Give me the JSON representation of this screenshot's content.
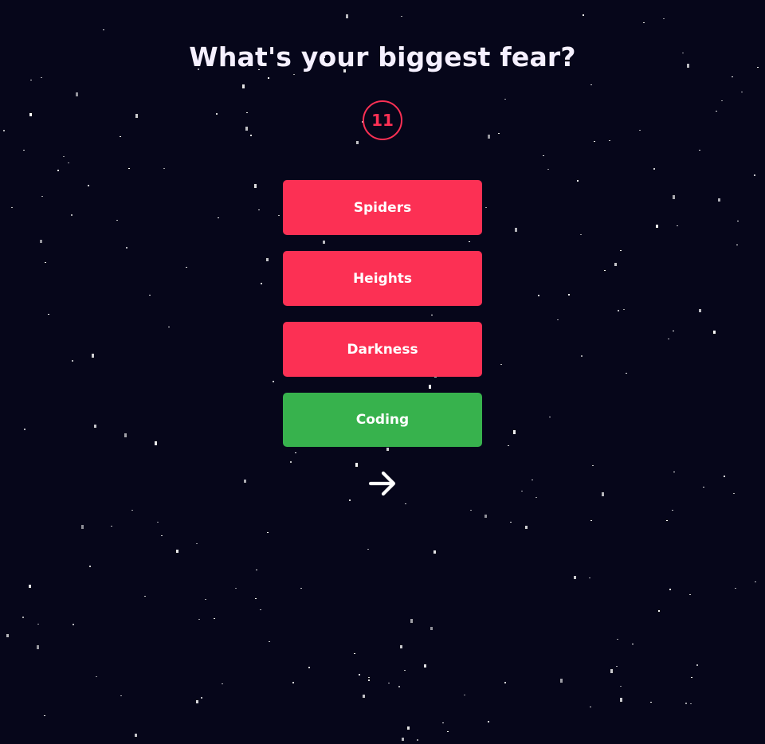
{
  "theme": {
    "background": "#06061a",
    "star_color": "#ffffff",
    "accent_red": "#fc3054",
    "correct_green": "#37b24d",
    "text_light": "#f5f0ff"
  },
  "quiz": {
    "question": "What's your biggest fear?",
    "timer": "11",
    "answers": [
      {
        "label": "Spiders",
        "state": "default"
      },
      {
        "label": "Heights",
        "state": "default"
      },
      {
        "label": "Darkness",
        "state": "default"
      },
      {
        "label": "Coding",
        "state": "correct"
      }
    ],
    "next_icon": "arrow-right-icon"
  }
}
